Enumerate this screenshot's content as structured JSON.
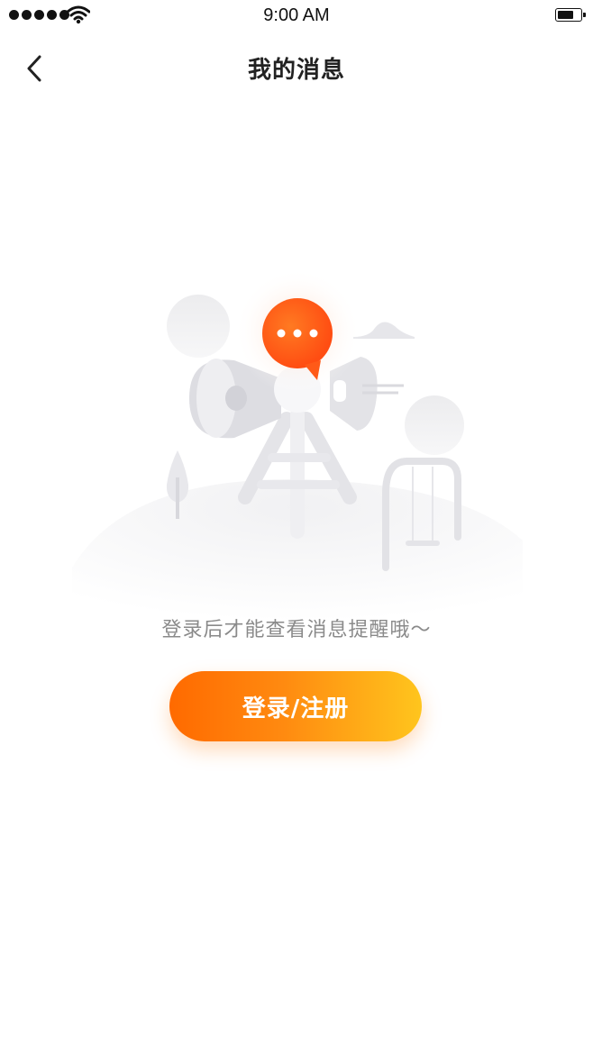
{
  "status_bar": {
    "time": "9:00 AM",
    "icons": [
      "signal-dots-icon",
      "wifi-icon",
      "battery-icon"
    ]
  },
  "nav": {
    "title": "我的消息",
    "back_icon": "chevron-left-icon"
  },
  "empty_state": {
    "illustration": "megaphone-tower-icon",
    "hint": "登录后才能查看消息提醒哦～",
    "button_label": "登录/注册"
  },
  "colors": {
    "accent_start": "#ff6a00",
    "accent_end": "#ffc51d",
    "bubble": "#ff5a1a",
    "hint_text": "#8a8a8a",
    "title_text": "#222222"
  }
}
